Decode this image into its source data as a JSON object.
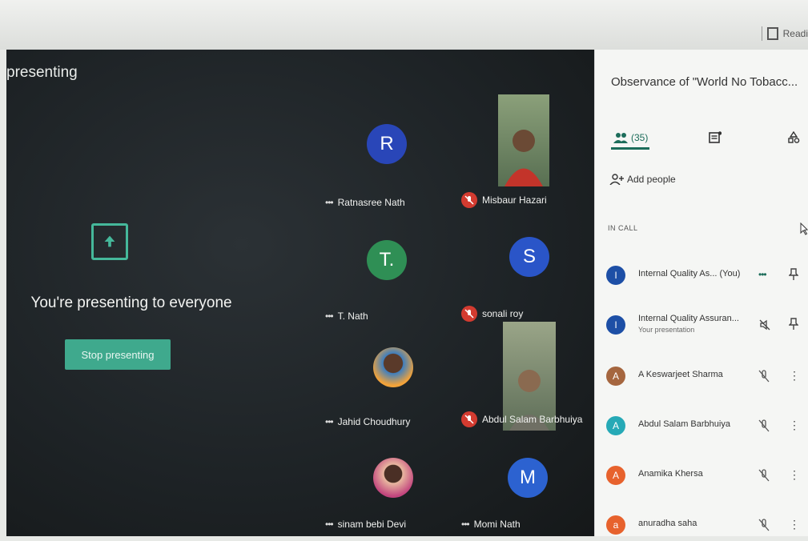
{
  "browser": {
    "reader_label": "Readi"
  },
  "stage": {
    "presenting_title": "presenting",
    "message": "You're presenting to everyone",
    "stop_label": "Stop presenting"
  },
  "tiles": [
    {
      "name": "Ratnasree Nath",
      "initial": "R",
      "avatar_color": "#2946b8",
      "muted": false
    },
    {
      "name": "Misbaur Hazari",
      "initial": "",
      "avatar_color": "",
      "muted": true
    },
    {
      "name": "T. Nath",
      "initial": "T.",
      "avatar_color": "#2f8f55",
      "muted": false
    },
    {
      "name": "sonali roy",
      "initial": "S",
      "avatar_color": "#2a55c8",
      "muted": true
    },
    {
      "name": "Jahid Choudhury",
      "initial": "",
      "avatar_color": "",
      "muted": false
    },
    {
      "name": "Abdul Salam Barbhuiya",
      "initial": "",
      "avatar_color": "",
      "muted": true
    },
    {
      "name": "sinam bebi Devi",
      "initial": "",
      "avatar_color": "",
      "muted": false
    },
    {
      "name": "Momi Nath",
      "initial": "M",
      "avatar_color": "#2c62d0",
      "muted": false
    }
  ],
  "panel": {
    "meeting_title": "Observance of \"World No Tobacc...",
    "people_count": "(35)",
    "add_people_label": "Add people",
    "in_call_label": "IN CALL"
  },
  "participants": [
    {
      "name": "Internal Quality As... (You)",
      "sub": "",
      "initial": "I",
      "color": "#1d4fa6"
    },
    {
      "name": "Internal Quality Assuran...",
      "sub": "Your presentation",
      "initial": "I",
      "color": "#1d4fa6"
    },
    {
      "name": "A Keswarjeet Sharma",
      "sub": "",
      "initial": "A",
      "color": "#a5663f"
    },
    {
      "name": "Abdul Salam Barbhuiya",
      "sub": "",
      "initial": "A",
      "color": "#26a9b6"
    },
    {
      "name": "Anamika Khersa",
      "sub": "",
      "initial": "A",
      "color": "#e7622d"
    },
    {
      "name": "anuradha saha",
      "sub": "",
      "initial": "a",
      "color": "#e7622d"
    }
  ],
  "colors": {
    "accent": "#3fa98d",
    "stage_bg": "#1d2225",
    "muted_red": "#d33b30"
  }
}
